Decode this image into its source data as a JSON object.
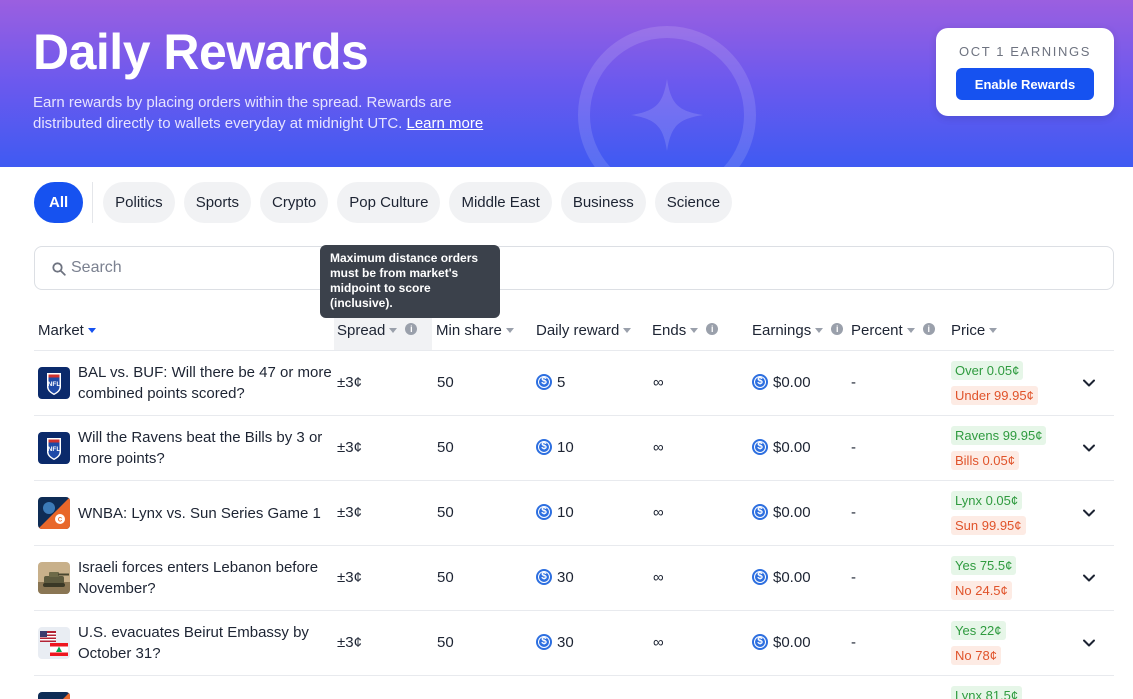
{
  "hero": {
    "title": "Daily Rewards",
    "description": "Earn rewards by placing orders within the spread. Rewards are distributed directly to wallets everyday at midnight UTC.",
    "learn_more": "Learn more",
    "earnings_label": "OCT 1 EARNINGS",
    "enable_button": "Enable Rewards"
  },
  "categories": [
    "All",
    "Politics",
    "Sports",
    "Crypto",
    "Pop Culture",
    "Middle East",
    "Business",
    "Science"
  ],
  "search": {
    "placeholder": "Search"
  },
  "tooltip": {
    "text": "Maximum distance orders must be from market's midpoint to score (inclusive)."
  },
  "columns": {
    "market": "Market",
    "spread": "Spread",
    "min_share": "Min share",
    "daily_reward": "Daily reward",
    "ends": "Ends",
    "earnings": "Earnings",
    "percent": "Percent",
    "price": "Price"
  },
  "rows": [
    {
      "market": "BAL vs. BUF: Will there be 47 or more combined points scored?",
      "thumb": "nfl-logo",
      "spread": "±3¢",
      "min_share": "50",
      "reward": "5",
      "ends": "∞",
      "earnings": "$0.00",
      "percent": "-",
      "price_up": "Over 0.05¢",
      "price_down": "Under 99.95¢"
    },
    {
      "market": "Will the Ravens beat the Bills by 3 or more points?",
      "thumb": "nfl-logo",
      "spread": "±3¢",
      "min_share": "50",
      "reward": "10",
      "ends": "∞",
      "earnings": "$0.00",
      "percent": "-",
      "price_up": "Ravens 99.95¢",
      "price_down": "Bills 0.05¢"
    },
    {
      "market": "WNBA: Lynx vs. Sun Series Game 1",
      "thumb": "wnba-logo",
      "spread": "±3¢",
      "min_share": "50",
      "reward": "10",
      "ends": "∞",
      "earnings": "$0.00",
      "percent": "-",
      "price_up": "Lynx 0.05¢",
      "price_down": "Sun 99.95¢"
    },
    {
      "market": "Israeli forces enters Lebanon before November?",
      "thumb": "tank-image",
      "spread": "±3¢",
      "min_share": "50",
      "reward": "30",
      "ends": "∞",
      "earnings": "$0.00",
      "percent": "-",
      "price_up": "Yes 75.5¢",
      "price_down": "No 24.5¢"
    },
    {
      "market": "U.S. evacuates Beirut Embassy by October 31?",
      "thumb": "flags-image",
      "spread": "±3¢",
      "min_share": "50",
      "reward": "30",
      "ends": "∞",
      "earnings": "$0.00",
      "percent": "-",
      "price_up": "Yes 22¢",
      "price_down": "No 78¢"
    },
    {
      "market": "",
      "thumb": "wnba-logo",
      "spread": "",
      "min_share": "",
      "reward": "",
      "ends": "",
      "earnings": "",
      "percent": "",
      "price_up": "Lynx 81.5¢",
      "price_down": ""
    }
  ],
  "colors": {
    "accent": "#1652f0",
    "up": "#2f9b3f",
    "down": "#e0532a"
  }
}
